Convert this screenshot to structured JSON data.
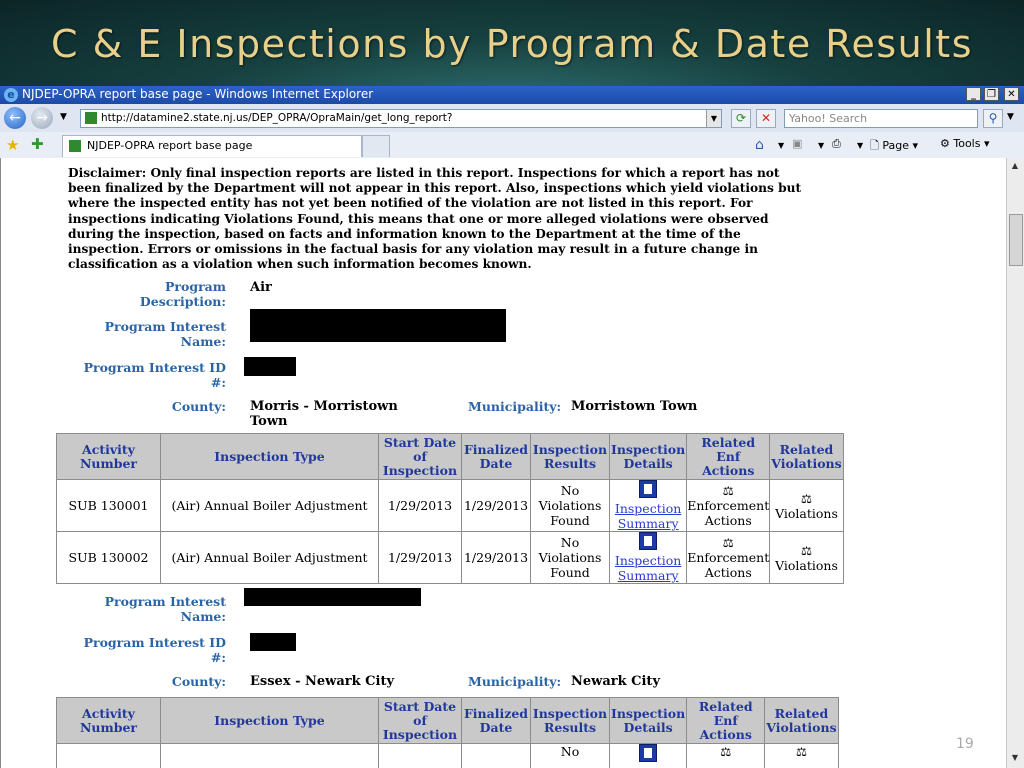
{
  "slide": {
    "title": "C & E Inspections by Program & Date Results",
    "page_number": "19"
  },
  "browser": {
    "window_title": "NJDEP-OPRA report base page - Windows Internet Explorer",
    "url": "http://datamine2.state.nj.us/DEP_OPRA/OpraMain/get_long_report?",
    "search_placeholder": "Yahoo! Search",
    "tab_title": "NJDEP-OPRA report base page",
    "commands": {
      "page": "Page",
      "tools": "Tools"
    }
  },
  "report": {
    "disclaimer": "Disclaimer: Only final inspection reports are listed in this report.  Inspections for which a report has not been finalized by the Department will not appear in this report.  Also, inspections which yield violations but where the inspected entity has not yet been notified of the violation are not listed in this report.  For inspections indicating Violations Found, this means that one or more alleged violations were observed during the inspection, based on facts and information known to the Department at the time of the inspection. Errors or omissions in the factual basis for any violation may result in a future change in classification as a violation when such information becomes known.",
    "labels": {
      "program_description": "Program Description:",
      "program_interest_name": "Program Interest Name:",
      "program_interest_id": "Program Interest ID #:",
      "county": "County:",
      "municipality": "Municipality:"
    },
    "program_description": "Air",
    "columns": [
      "Activity Number",
      "Inspection Type",
      "Start Date of Inspection",
      "Finalized Date",
      "Inspection Results",
      "Inspection Details",
      "Related Enf Actions",
      "Related Violations"
    ],
    "sites": [
      {
        "county": "Morris - Morristown Town",
        "municipality": "Morristown Town",
        "rows": [
          {
            "activity": "SUB  130001",
            "type": "(Air) Annual Boiler Adjustment",
            "start": "1/29/2013",
            "finalized": "1/29/2013",
            "result": "No Violations Found",
            "details": "Inspection Summary",
            "enf": "Enforcement Actions",
            "viol": "Violations"
          },
          {
            "activity": "SUB  130002",
            "type": "(Air) Annual Boiler Adjustment",
            "start": "1/29/2013",
            "finalized": "1/29/2013",
            "result": "No Violations Found",
            "details": "Inspection Summary",
            "enf": "Enforcement Actions",
            "viol": "Violations"
          }
        ]
      },
      {
        "county": "Essex - Newark City",
        "municipality": "Newark City",
        "rows": [
          {
            "result": "No"
          }
        ]
      }
    ]
  },
  "colors": {
    "label_blue": "#2a64a6",
    "header_blue": "#20389a",
    "result_green": "#2eaa2e",
    "title_gold": "#e9d08a"
  }
}
